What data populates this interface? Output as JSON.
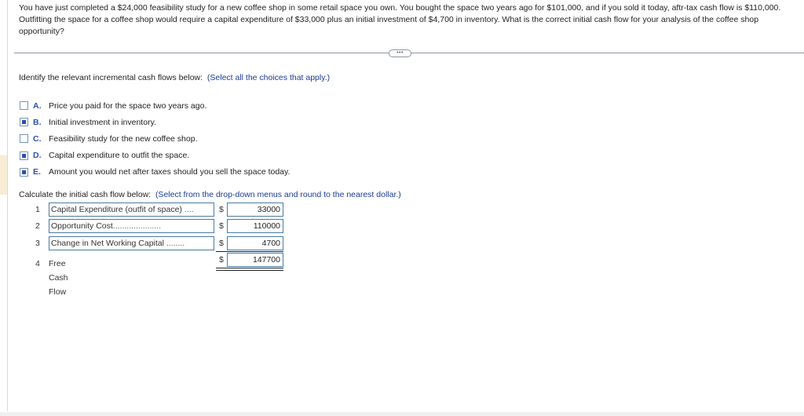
{
  "question": {
    "text": "You have just completed a $24,000 feasibility study for a new coffee shop in some retail space you own. You bought the space two years ago for $101,000, and if you sold it today, aftr-tax cash flow is $110,000. Outfitting the space for a coffee shop would require a capital expenditure of $33,000 plus an initial investment of $4,700 in inventory. What is the correct initial cash flow for your analysis of the coffee shop opportunity?"
  },
  "divider": {
    "more_label": "•••"
  },
  "part1": {
    "instruction": "Identify the relevant incremental cash flows below:",
    "hint": "(Select all the choices that apply.)",
    "choices": [
      {
        "letter": "A.",
        "text": "Price you paid for the space two years ago.",
        "checked": false
      },
      {
        "letter": "B.",
        "text": "Initial investment in inventory.",
        "checked": true
      },
      {
        "letter": "C.",
        "text": "Feasibility study for the new coffee shop.",
        "checked": false
      },
      {
        "letter": "D.",
        "text": "Capital expenditure to outfit the space.",
        "checked": true
      },
      {
        "letter": "E.",
        "text": "Amount you would net after taxes should you sell the space today.",
        "checked": true
      }
    ]
  },
  "part2": {
    "instruction": "Calculate the initial cash flow below:",
    "hint": "(Select from the drop-down menus and round to the nearest dollar.)",
    "currency": "$",
    "rows": [
      {
        "num": "1",
        "label": "Capital Expenditure (outfit of space)",
        "dots": " ....",
        "value": "33000"
      },
      {
        "num": "2",
        "label": "Opportunity Cost",
        "dots": ".....................",
        "value": "110000"
      },
      {
        "num": "3",
        "label": "Change in Net Working Capital",
        "dots": " ........",
        "value": "4700"
      },
      {
        "num": "4",
        "label": "Free Cash Flow",
        "value": "147700"
      }
    ]
  }
}
